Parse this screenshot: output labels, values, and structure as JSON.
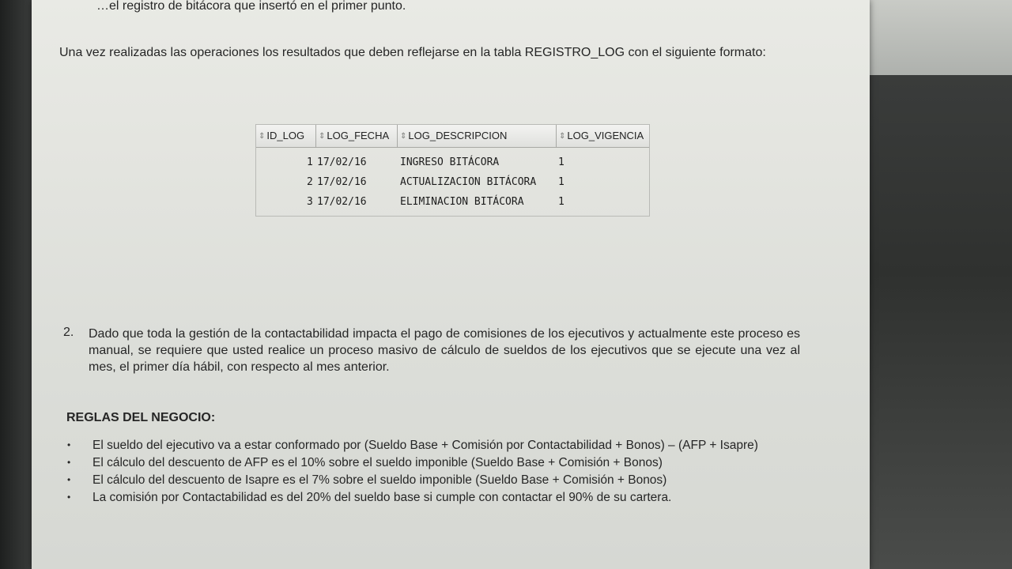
{
  "document": {
    "top_line": "…el registro de bitácora que insertó en el primer punto.",
    "paragraph_1": "Una vez realizadas las operaciones los resultados que deben reflejarse en la tabla REGISTRO_LOG con el siguiente formato:",
    "table": {
      "columns": [
        "ID_LOG",
        "LOG_FECHA",
        "LOG_DESCRIPCION",
        "LOG_VIGENCIA"
      ],
      "rows": [
        [
          "1",
          "17/02/16",
          "INGRESO BITÁCORA",
          "1"
        ],
        [
          "2",
          "17/02/16",
          "ACTUALIZACION BITÁCORA",
          "1"
        ],
        [
          "3",
          "17/02/16",
          "ELIMINACION BITÁCORA",
          "1"
        ]
      ]
    },
    "item_2_number": "2.",
    "item_2_text": "Dado que toda la gestión de la contactabilidad impacta el pago de comisiones de los ejecutivos y actualmente este proceso es manual, se requiere que usted realice un proceso masivo de cálculo de sueldos de los ejecutivos que se ejecute una vez al mes, el primer día hábil, con respecto al mes anterior.",
    "rules_heading": "REGLAS DEL NEGOCIO:",
    "rules": [
      "El sueldo del ejecutivo va a estar conformado por (Sueldo Base + Comisión por Contactabilidad + Bonos) – (AFP + Isapre)",
      "El cálculo del descuento de AFP es el 10% sobre el sueldo imponible (Sueldo Base + Comisión + Bonos)",
      "El cálculo del descuento de Isapre es el 7% sobre el sueldo imponible (Sueldo Base + Comisión + Bonos)",
      "La comisión por Contactabilidad es del 20% del sueldo base si cumple con contactar el 90% de su cartera."
    ],
    "bullet_glyph": "•",
    "sort_icon_glyph": "⇕"
  }
}
